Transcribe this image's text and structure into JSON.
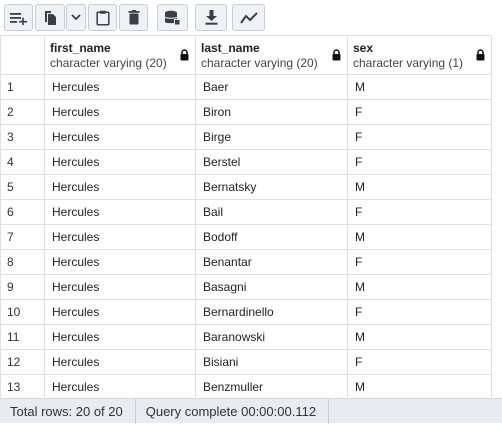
{
  "toolbar": {
    "buttons": [
      {
        "icon": "add-row-icon"
      },
      {
        "icon": "copy-icon"
      },
      {
        "icon": "chevron-down-icon"
      },
      {
        "icon": "paste-icon"
      },
      {
        "icon": "delete-icon"
      },
      {
        "icon": "save-data-icon"
      },
      {
        "icon": "download-icon"
      },
      {
        "icon": "graph-icon"
      }
    ]
  },
  "grid": {
    "columns": [
      {
        "name": "first_name",
        "type": "character varying (20)",
        "locked": true
      },
      {
        "name": "last_name",
        "type": "character varying (20)",
        "locked": true
      },
      {
        "name": "sex",
        "type": "character varying (1)",
        "locked": true
      }
    ],
    "rows": [
      {
        "n": "1",
        "first_name": "Hercules",
        "last_name": "Baer",
        "sex": "M"
      },
      {
        "n": "2",
        "first_name": "Hercules",
        "last_name": "Biron",
        "sex": "F"
      },
      {
        "n": "3",
        "first_name": "Hercules",
        "last_name": "Birge",
        "sex": "F"
      },
      {
        "n": "4",
        "first_name": "Hercules",
        "last_name": "Berstel",
        "sex": "F"
      },
      {
        "n": "5",
        "first_name": "Hercules",
        "last_name": "Bernatsky",
        "sex": "M"
      },
      {
        "n": "6",
        "first_name": "Hercules",
        "last_name": "Bail",
        "sex": "F"
      },
      {
        "n": "7",
        "first_name": "Hercules",
        "last_name": "Bodoff",
        "sex": "M"
      },
      {
        "n": "8",
        "first_name": "Hercules",
        "last_name": "Benantar",
        "sex": "F"
      },
      {
        "n": "9",
        "first_name": "Hercules",
        "last_name": "Basagni",
        "sex": "M"
      },
      {
        "n": "10",
        "first_name": "Hercules",
        "last_name": "Bernardinello",
        "sex": "F"
      },
      {
        "n": "11",
        "first_name": "Hercules",
        "last_name": "Baranowski",
        "sex": "M"
      },
      {
        "n": "12",
        "first_name": "Hercules",
        "last_name": "Bisiani",
        "sex": "F"
      },
      {
        "n": "13",
        "first_name": "Hercules",
        "last_name": "Benzmuller",
        "sex": "M"
      }
    ]
  },
  "status": {
    "total_rows": "Total rows: 20 of 20",
    "query": "Query complete 00:00:00.112"
  },
  "colors": {
    "accent": "#222222",
    "toolbar_bg": "#eef1f5",
    "statusbar_bg": "#e8ecf1",
    "grid_border": "#dde0e6"
  }
}
